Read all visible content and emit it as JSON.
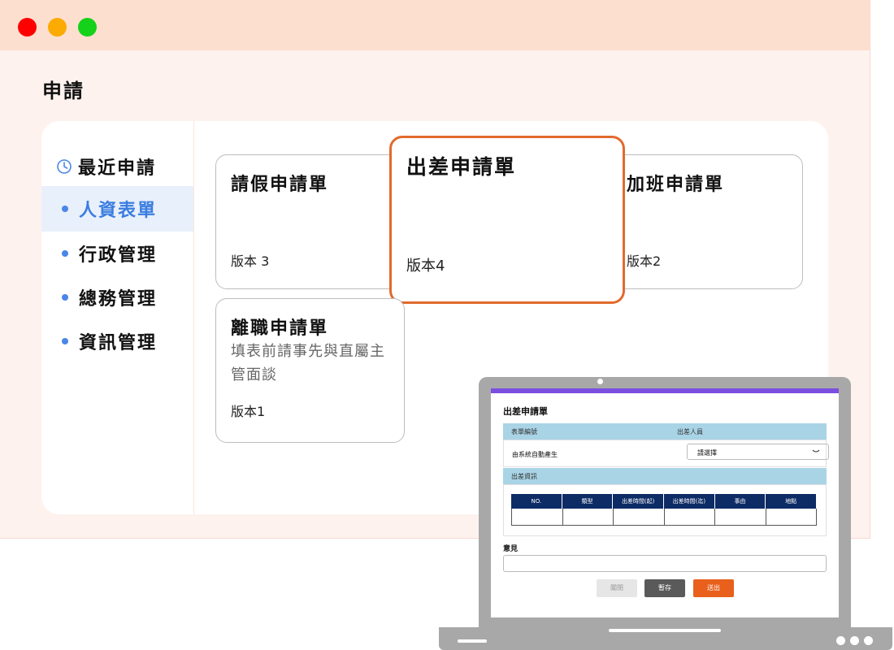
{
  "window": {
    "controls": [
      "close",
      "minimize",
      "maximize"
    ]
  },
  "page": {
    "title": "申請"
  },
  "sidebar": {
    "items": [
      {
        "label": "最近申請",
        "icon": "clock-icon",
        "active": false
      },
      {
        "label": "人資表單",
        "active": true
      },
      {
        "label": "行政管理",
        "active": false
      },
      {
        "label": "總務管理",
        "active": false
      },
      {
        "label": "資訊管理",
        "active": false
      }
    ]
  },
  "cards": [
    {
      "title": "請假申請單",
      "version": "版本 3"
    },
    {
      "title": "出差申請單",
      "version": "版本4",
      "selected": true
    },
    {
      "title": "加班申請單",
      "version": "版本2"
    },
    {
      "title": "離職申請單",
      "description": "填表前請事先與直屬主管面談",
      "version": "版本1"
    }
  ],
  "form_preview": {
    "title": "出差申請單",
    "field_form_number_label": "表單編號",
    "field_traveler_label": "出差人員",
    "form_number_value": "由系統自動產生",
    "traveler_select_value": "請選擇",
    "section_travel_info": "出差資訊",
    "table_headers": [
      "NO.",
      "類型",
      "出差時間(起)",
      "出差時間(迄)",
      "事由",
      "地點"
    ],
    "opinion_label": "意見",
    "buttons": {
      "close": "關閉",
      "save": "暫存",
      "submit": "送出"
    }
  },
  "colors": {
    "titlebar": "#fddfd0",
    "window_bg": "#fef2ee",
    "accent_blue": "#3a7de0",
    "selected_border": "#e26a2c",
    "table_header": "#0d2b64",
    "form_band": "#a9d4e6",
    "submit_button": "#e8601c"
  }
}
